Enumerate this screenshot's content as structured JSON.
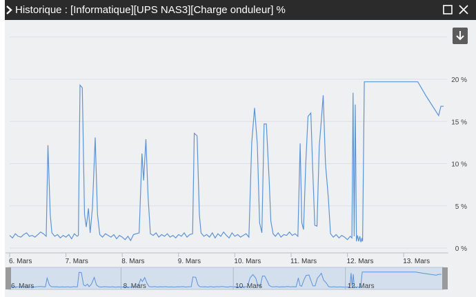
{
  "window": {
    "title": "Historique : [Informatique][UPS NAS3][Charge onduleur] %",
    "title_icon": "chevron-right-icon",
    "maximize_icon": "maximize-icon",
    "close_icon": "close-icon",
    "download_icon": "download-arrow-icon"
  },
  "colors": {
    "titlebar": "#2b2b2b",
    "line": "#5b93d6",
    "navigator_mask": "rgba(91,147,214,0.18)"
  },
  "chart_data": {
    "type": "line",
    "ylim": [
      0,
      22
    ],
    "yticks": [
      0,
      5,
      10,
      15,
      20
    ],
    "ytick_labels": [
      "0 %",
      "5 %",
      "10 %",
      "15 %",
      "20 %"
    ],
    "xlim": [
      6.0,
      13.75
    ],
    "xticks": [
      6,
      7,
      8,
      9,
      10,
      11,
      12,
      13
    ],
    "xtick_labels": [
      "6. Mars",
      "7. Mars",
      "8. Mars",
      "9. Mars",
      "10. Mars",
      "11. Mars",
      "12. Mars",
      "13. Mars"
    ],
    "navigator_labels": [
      "6. Mars",
      "8. Mars",
      "10. Mars",
      "12. Mars"
    ],
    "navigator_label_days": [
      6,
      8,
      10,
      12
    ],
    "series": [
      {
        "points": [
          [
            6.0,
            1.5
          ],
          [
            6.05,
            1.2
          ],
          [
            6.1,
            1.7
          ],
          [
            6.15,
            1.4
          ],
          [
            6.2,
            1.3
          ],
          [
            6.25,
            1.6
          ],
          [
            6.3,
            1.8
          ],
          [
            6.35,
            1.4
          ],
          [
            6.4,
            1.5
          ],
          [
            6.45,
            1.3
          ],
          [
            6.5,
            1.6
          ],
          [
            6.55,
            1.9
          ],
          [
            6.6,
            1.7
          ],
          [
            6.65,
            1.4
          ],
          [
            6.68,
            12.2
          ],
          [
            6.72,
            4.0
          ],
          [
            6.75,
            1.8
          ],
          [
            6.8,
            1.4
          ],
          [
            6.85,
            1.6
          ],
          [
            6.9,
            1.2
          ],
          [
            6.95,
            1.5
          ],
          [
            7.0,
            1.3
          ],
          [
            7.05,
            1.6
          ],
          [
            7.1,
            1.1
          ],
          [
            7.15,
            1.7
          ],
          [
            7.2,
            1.4
          ],
          [
            7.22,
            1.5
          ],
          [
            7.25,
            19.3
          ],
          [
            7.29,
            19.0
          ],
          [
            7.33,
            4.0
          ],
          [
            7.36,
            2.5
          ],
          [
            7.4,
            4.7
          ],
          [
            7.43,
            1.8
          ],
          [
            7.47,
            4.8
          ],
          [
            7.52,
            13.1
          ],
          [
            7.56,
            4.0
          ],
          [
            7.6,
            1.6
          ],
          [
            7.65,
            1.3
          ],
          [
            7.7,
            1.7
          ],
          [
            7.75,
            1.5
          ],
          [
            7.8,
            1.3
          ],
          [
            7.85,
            1.6
          ],
          [
            7.9,
            1.1
          ],
          [
            7.95,
            1.5
          ],
          [
            8.0,
            1.3
          ],
          [
            8.05,
            1.0
          ],
          [
            8.1,
            1.4
          ],
          [
            8.15,
            0.9
          ],
          [
            8.2,
            1.6
          ],
          [
            8.3,
            1.8
          ],
          [
            8.35,
            11.2
          ],
          [
            8.38,
            8.0
          ],
          [
            8.42,
            12.9
          ],
          [
            8.46,
            6.0
          ],
          [
            8.5,
            1.7
          ],
          [
            8.55,
            1.5
          ],
          [
            8.6,
            1.8
          ],
          [
            8.65,
            1.3
          ],
          [
            8.7,
            1.6
          ],
          [
            8.75,
            1.4
          ],
          [
            8.8,
            1.7
          ],
          [
            8.85,
            1.3
          ],
          [
            8.9,
            1.5
          ],
          [
            8.95,
            1.2
          ],
          [
            9.0,
            1.6
          ],
          [
            9.05,
            1.4
          ],
          [
            9.1,
            1.8
          ],
          [
            9.15,
            1.3
          ],
          [
            9.2,
            1.6
          ],
          [
            9.25,
            1.7
          ],
          [
            9.28,
            13.6
          ],
          [
            9.33,
            13.3
          ],
          [
            9.37,
            4.0
          ],
          [
            9.4,
            1.8
          ],
          [
            9.45,
            1.4
          ],
          [
            9.5,
            1.6
          ],
          [
            9.55,
            1.3
          ],
          [
            9.6,
            1.8
          ],
          [
            9.65,
            1.2
          ],
          [
            9.7,
            1.7
          ],
          [
            9.75,
            1.4
          ],
          [
            9.8,
            1.9
          ],
          [
            9.85,
            1.5
          ],
          [
            9.9,
            1.2
          ],
          [
            9.95,
            1.8
          ],
          [
            10.0,
            1.4
          ],
          [
            10.05,
            1.6
          ],
          [
            10.1,
            1.3
          ],
          [
            10.15,
            1.5
          ],
          [
            10.2,
            1.7
          ],
          [
            10.25,
            1.3
          ],
          [
            10.3,
            12.5
          ],
          [
            10.35,
            16.6
          ],
          [
            10.4,
            12.3
          ],
          [
            10.44,
            3.0
          ],
          [
            10.48,
            1.8
          ],
          [
            10.52,
            14.7
          ],
          [
            10.56,
            14.7
          ],
          [
            10.61,
            8.0
          ],
          [
            10.64,
            3.2
          ],
          [
            10.68,
            1.7
          ],
          [
            10.72,
            1.4
          ],
          [
            10.77,
            1.8
          ],
          [
            10.82,
            1.3
          ],
          [
            10.87,
            1.6
          ],
          [
            10.92,
            1.5
          ],
          [
            10.97,
            1.9
          ],
          [
            11.02,
            1.5
          ],
          [
            11.07,
            1.7
          ],
          [
            11.12,
            1.4
          ],
          [
            11.16,
            12.4
          ],
          [
            11.19,
            3.0
          ],
          [
            11.22,
            2.2
          ],
          [
            11.26,
            10.0
          ],
          [
            11.3,
            15.6
          ],
          [
            11.35,
            16.0
          ],
          [
            11.38,
            10.0
          ],
          [
            11.42,
            2.7
          ],
          [
            11.46,
            2.6
          ],
          [
            11.5,
            12.1
          ],
          [
            11.53,
            14.5
          ],
          [
            11.57,
            18.1
          ],
          [
            11.61,
            10.0
          ],
          [
            11.66,
            6.0
          ],
          [
            11.7,
            1.7
          ],
          [
            11.75,
            1.3
          ],
          [
            11.8,
            1.6
          ],
          [
            11.85,
            1.2
          ],
          [
            11.9,
            1.5
          ],
          [
            11.95,
            1.3
          ],
          [
            12.0,
            1.0
          ],
          [
            12.05,
            1.4
          ],
          [
            12.08,
            1.2
          ],
          [
            12.1,
            18.4
          ],
          [
            12.12,
            1.4
          ],
          [
            12.14,
            17.0
          ],
          [
            12.16,
            0.8
          ],
          [
            12.18,
            1.5
          ],
          [
            12.2,
            0.8
          ],
          [
            12.22,
            1.4
          ],
          [
            12.24,
            0.7
          ],
          [
            12.26,
            1.2
          ],
          [
            12.27,
            0.8
          ],
          [
            12.3,
            19.7
          ],
          [
            12.6,
            19.7
          ],
          [
            13.0,
            19.7
          ],
          [
            13.25,
            19.7
          ],
          [
            13.4,
            18.0
          ],
          [
            13.62,
            15.7
          ],
          [
            13.66,
            16.8
          ],
          [
            13.71,
            16.8
          ]
        ]
      }
    ],
    "navigator_window": [
      6.0,
      13.75
    ]
  }
}
